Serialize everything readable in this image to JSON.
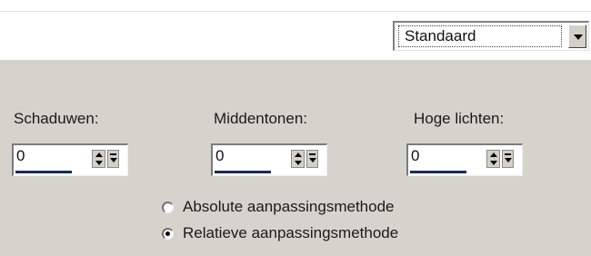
{
  "preset": {
    "selected": "Standaard",
    "icon": "chevron-down-icon"
  },
  "levels": [
    {
      "label": "Schaduwen:",
      "value": "0"
    },
    {
      "label": "Middentonen:",
      "value": "0"
    },
    {
      "label": "Hoge lichten:",
      "value": "0"
    }
  ],
  "method": {
    "options": [
      {
        "label": "Absolute aanpassingsmethode",
        "checked": false
      },
      {
        "label": "Relatieve aanpassingsmethode",
        "checked": true
      }
    ]
  },
  "colors": {
    "panel": "#d6d3cd",
    "field": "#ffffff",
    "slider_bar": "#1a2a55"
  }
}
